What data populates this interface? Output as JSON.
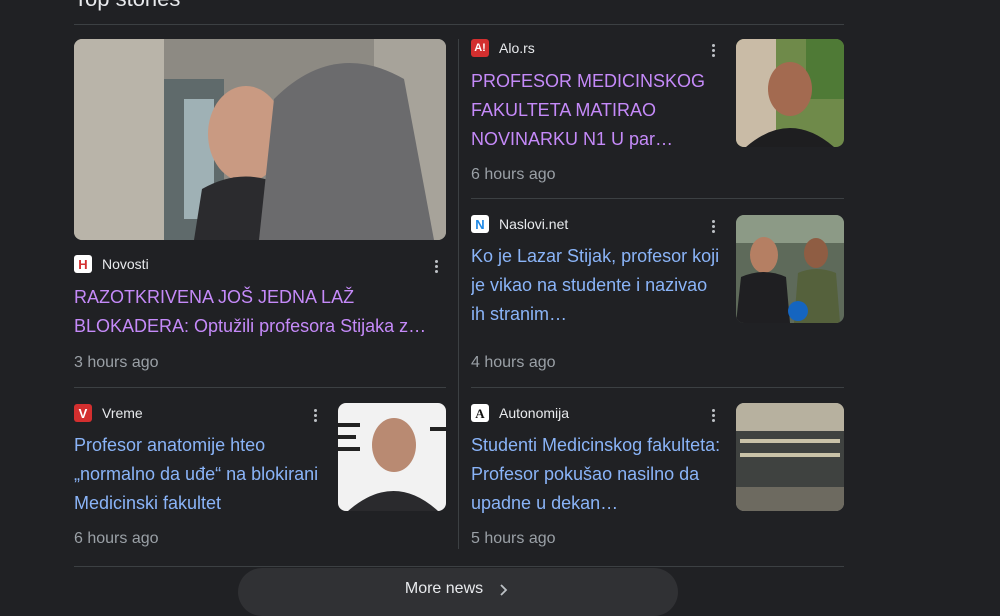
{
  "section": {
    "title": "Top stories"
  },
  "stories": [
    {
      "source": "Novosti",
      "logo_letter": "H",
      "logo_bg": "#ffffff",
      "logo_fg": "#d32f2f",
      "headline": "RAZOTKRIVENA JOŠ JEDNA LAŽ BLOKADERA: Optužili profesora Stijaka z…",
      "time": "3 hours ago",
      "visited": true
    },
    {
      "source": "Alo.rs",
      "logo_letter": "A!",
      "logo_bg": "#d32f2f",
      "logo_fg": "#ffffff",
      "headline": "PROFESOR MEDICINSKOG FAKULTETA MATIRAO NOVINARKU N1 U par…",
      "time": "6 hours ago",
      "visited": true
    },
    {
      "source": "Naslovi.net",
      "logo_letter": "N",
      "logo_bg": "#ffffff",
      "logo_fg": "#1e88e5",
      "headline": "Ko je Lazar Stijak, profesor koji je vikao na studente i nazivao ih stranim…",
      "time": "4 hours ago",
      "visited": false
    },
    {
      "source": "Vreme",
      "logo_letter": "V",
      "logo_bg": "#d32f2f",
      "logo_fg": "#ffffff",
      "headline": "Profesor anatomije hteo „normalno da uđe“ na blokirani Medicinski fakultet",
      "time": "6 hours ago",
      "visited": false
    },
    {
      "source": "Autonomija",
      "logo_letter": "A",
      "logo_bg": "#ffffff",
      "logo_fg": "#111111",
      "headline": "Studenti Medicinskog fakulteta: Profesor pokušao nasilno da upadne u dekan…",
      "time": "5 hours ago",
      "visited": false
    }
  ],
  "more_news": {
    "label": "More news"
  },
  "colors": {
    "link": "#8ab4f8",
    "visited": "#c58af9",
    "meta": "#9aa0a6",
    "background": "#202124"
  }
}
